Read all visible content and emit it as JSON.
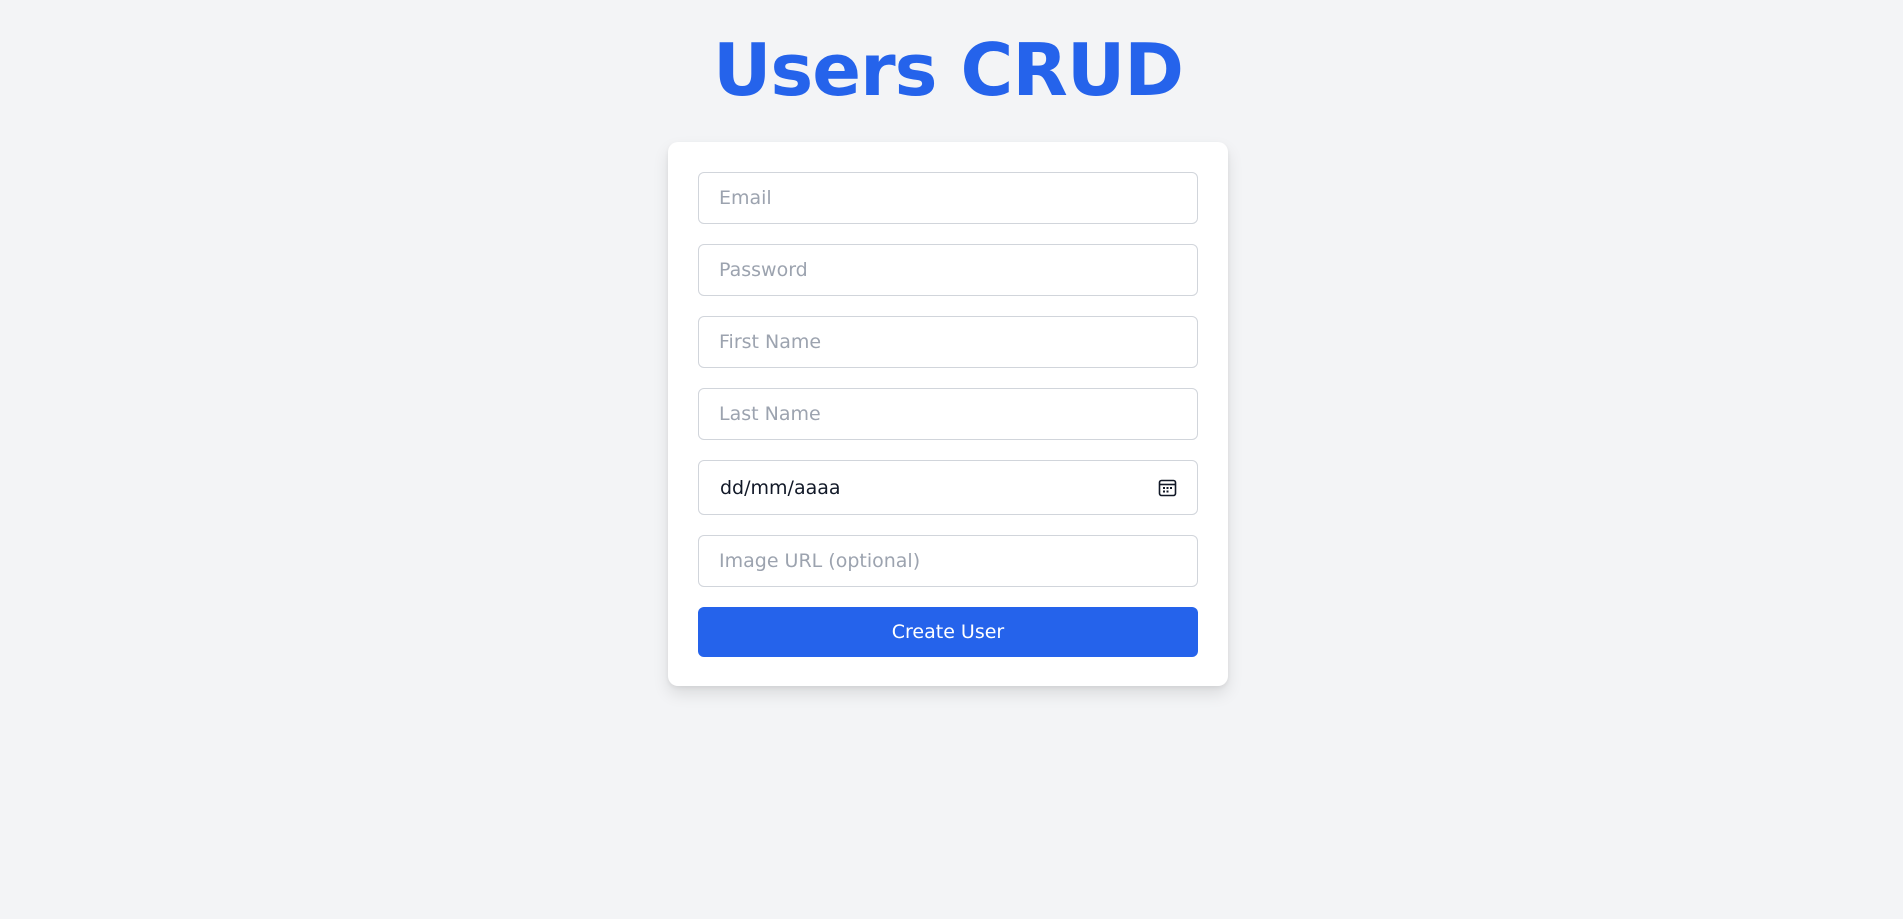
{
  "page": {
    "title": "Users CRUD"
  },
  "form": {
    "email_placeholder": "Email",
    "password_placeholder": "Password",
    "first_name_placeholder": "First Name",
    "last_name_placeholder": "Last Name",
    "birth_date_display": "dd/mm/aaaa",
    "image_url_placeholder": "Image URL (optional)",
    "submit_label": "Create User"
  },
  "icons": {
    "date_picker": "calendar-icon"
  },
  "colors": {
    "accent": "#2563eb",
    "background": "#f3f4f6",
    "card": "#ffffff",
    "input_border": "#d1d5db",
    "placeholder": "#9ca3af"
  }
}
